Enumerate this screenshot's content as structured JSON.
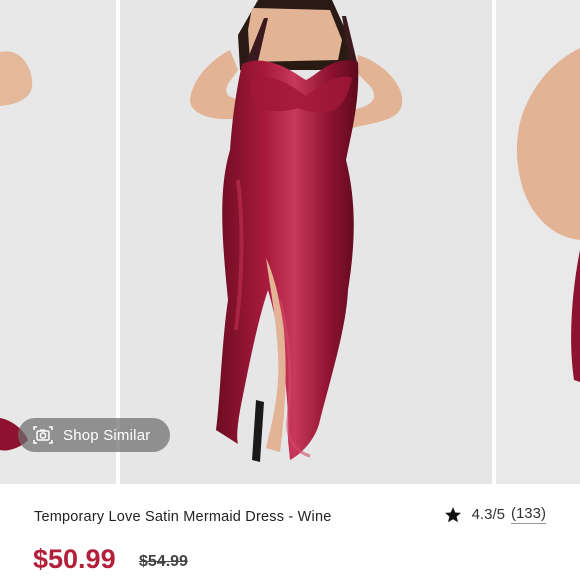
{
  "gallery": {
    "images": [
      {
        "subject": "model in wine satin dress, side view (partial)"
      },
      {
        "subject": "model in wine satin mermaid dress, front view"
      },
      {
        "subject": "model in wine satin dress, back/side view (partial)"
      }
    ],
    "shop_similar_label": "Shop Similar"
  },
  "product": {
    "title": "Temporary Love Satin Mermaid Dress - Wine",
    "rating_score": "4.3/5",
    "rating_count": "(133)",
    "price": "$50.99",
    "original_price": "$54.99"
  },
  "colors": {
    "price": "#b3203a",
    "dress": "#8e1230",
    "pill_background": "rgba(110,110,110,0.72)"
  }
}
